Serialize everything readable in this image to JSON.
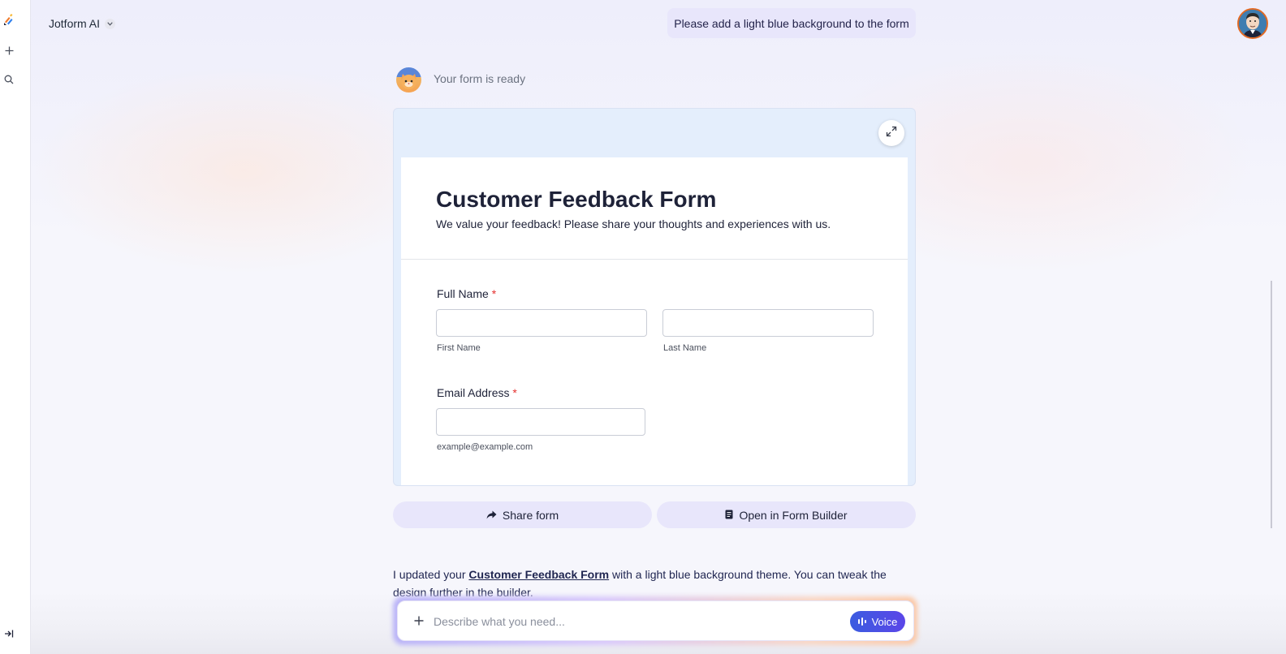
{
  "app": {
    "name": "Jotform AI"
  },
  "conversation": {
    "user_message": "Please add a light blue background to the form",
    "bot_status": "Your form is ready",
    "reply": {
      "before_link": "I updated your ",
      "link_text": "Customer Feedback Form",
      "after_link": " with a light blue background theme. You can tweak the design further in the builder."
    }
  },
  "form_preview": {
    "title": "Customer Feedback Form",
    "subtitle": "We value your feedback! Please share your thoughts and experiences with us.",
    "fields": {
      "full_name": {
        "label": "Full Name",
        "required_mark": "*",
        "first_sublabel": "First Name",
        "last_sublabel": "Last Name"
      },
      "email": {
        "label": "Email Address",
        "required_mark": "*",
        "sublabel": "example@example.com"
      }
    },
    "background_color": "#e4eefc"
  },
  "actions": {
    "share_label": "Share form",
    "open_builder_label": "Open in Form Builder"
  },
  "composer": {
    "placeholder": "Describe what you need...",
    "voice_label": "Voice"
  },
  "icons": {
    "rail": [
      "jotform-logo-icon",
      "plus-icon",
      "search-icon",
      "collapse-sidebar-icon"
    ],
    "preview": [
      "expand-icon"
    ],
    "actions": [
      "share-arrow-icon",
      "form-builder-icon"
    ],
    "composer": [
      "plus-icon",
      "voice-waveform-icon"
    ]
  },
  "colors": {
    "accent": "#4f52e6",
    "bubble": "#e8e6fb",
    "required": "#e5312f",
    "avatar_border": "#e36a24"
  }
}
